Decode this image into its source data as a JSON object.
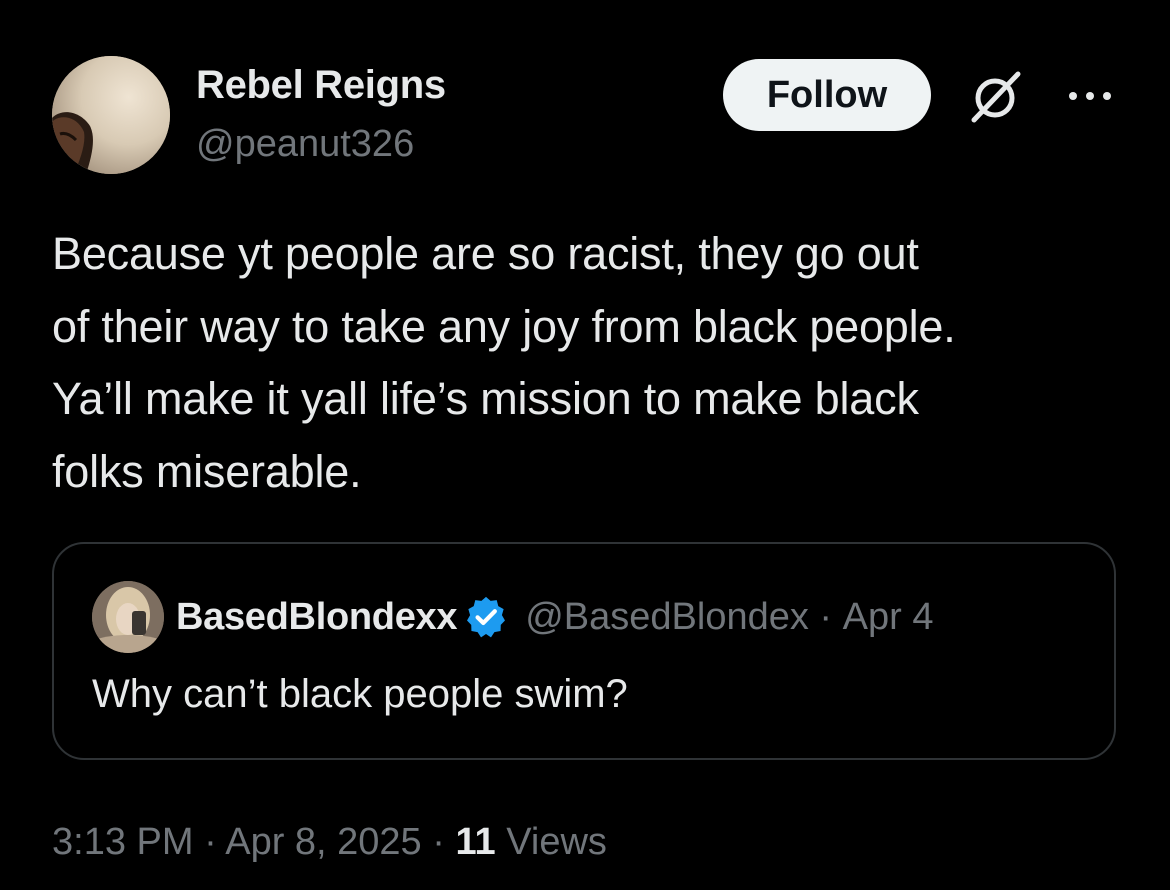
{
  "author": {
    "display_name": "Rebel Reigns",
    "handle": "@peanut326"
  },
  "actions": {
    "follow_label": "Follow"
  },
  "tweet": {
    "text": "Because yt people are so racist, they go out\nof their way to take any joy from black people.\nYa’ll make it yall life’s mission to make black\nfolks miserable."
  },
  "quoted_tweet": {
    "display_name": "BasedBlondexx",
    "verified": true,
    "handle": "@BasedBlondex",
    "separator": " · ",
    "date": "Apr 4",
    "text": "Why can’t black people swim?"
  },
  "meta": {
    "time": "3:13 PM",
    "separator": " · ",
    "date": "Apr 8, 2025",
    "views_count": "11",
    "views_label": " Views"
  },
  "colors": {
    "background": "#000000",
    "primary_text": "#e7e9ea",
    "secondary_text": "#71767b",
    "follow_button_bg": "#eff3f4",
    "border": "#2f3336",
    "verified_badge": "#1d9bf0"
  },
  "icons": {
    "grok": "grok-icon",
    "more": "more-icon",
    "verified": "verified-badge-icon"
  }
}
